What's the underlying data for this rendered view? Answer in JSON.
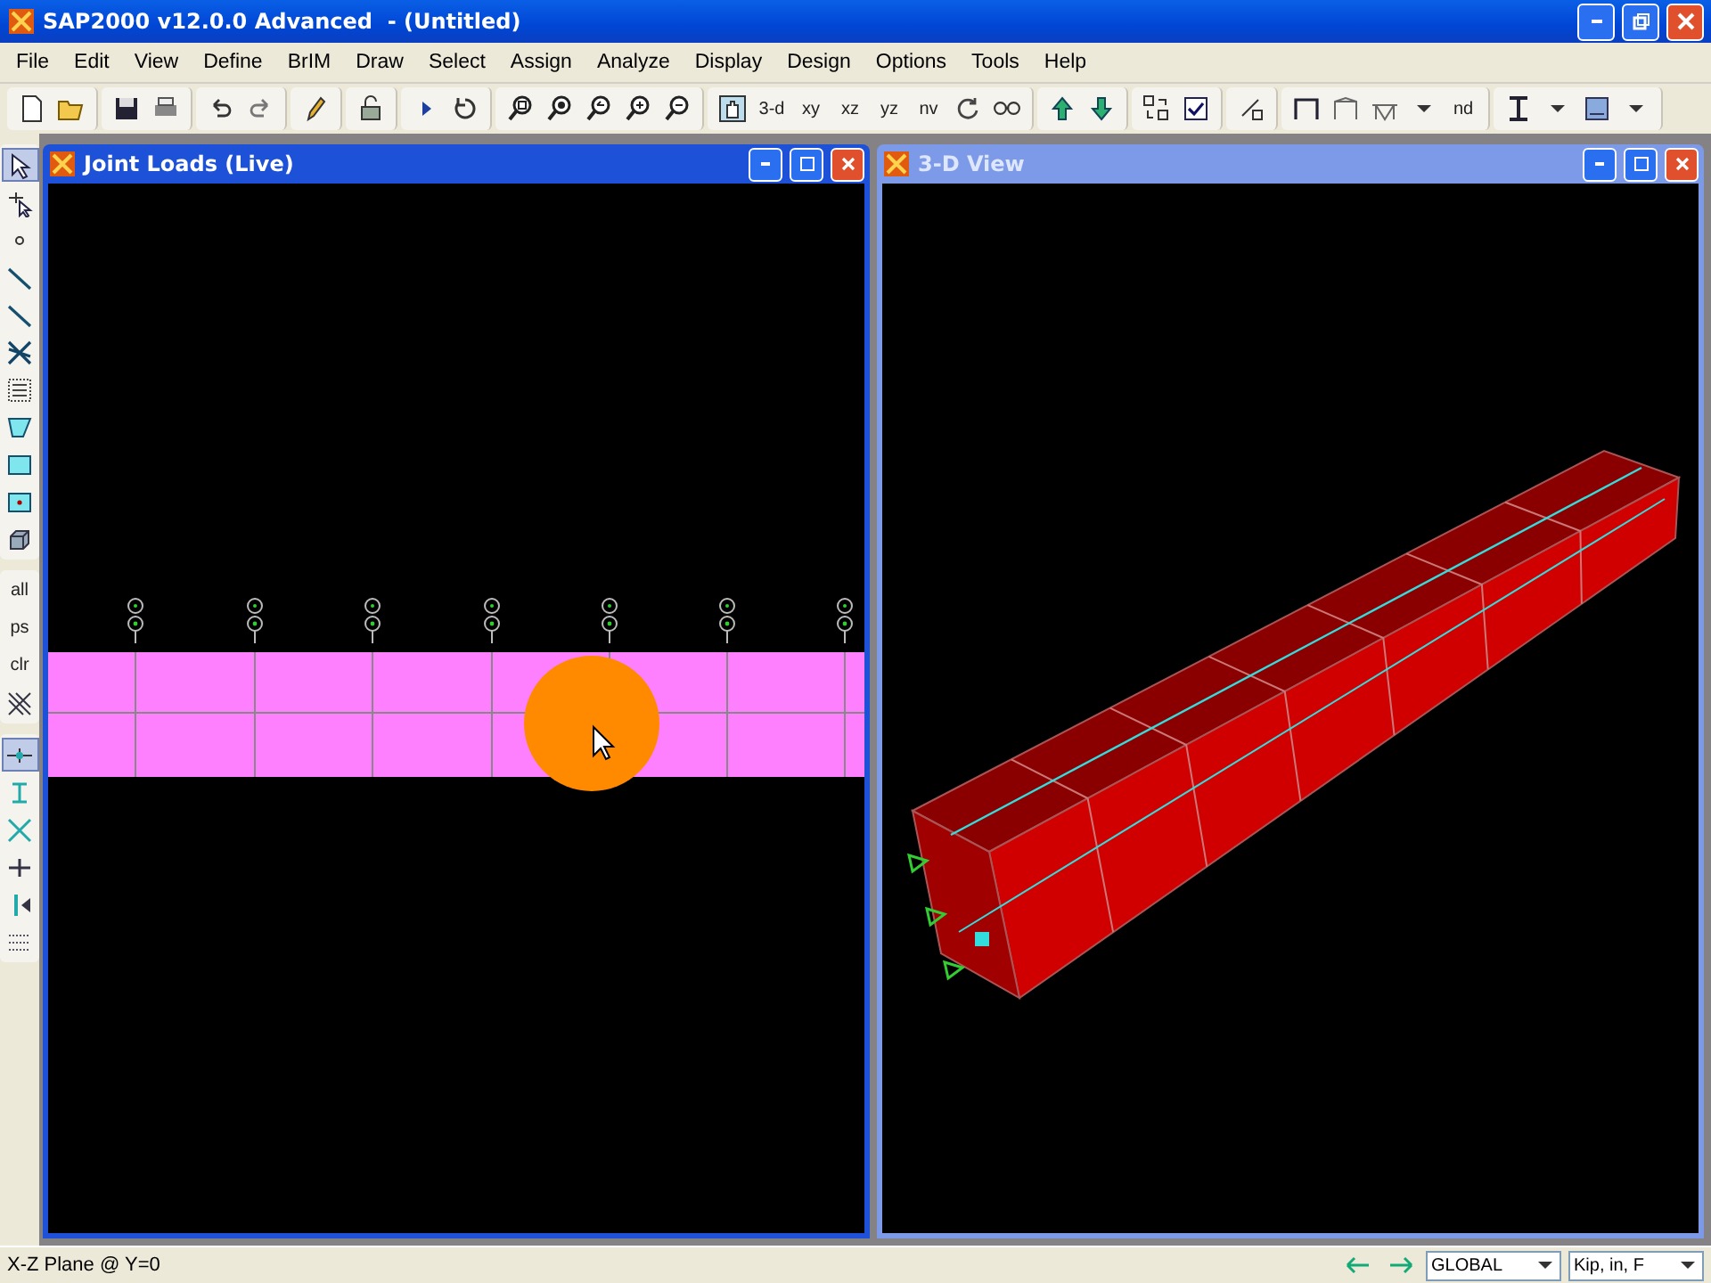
{
  "app": {
    "title": "SAP2000 v12.0.0 Advanced  - (Untitled)"
  },
  "menu": [
    "File",
    "Edit",
    "View",
    "Define",
    "BrIM",
    "Draw",
    "Select",
    "Assign",
    "Analyze",
    "Display",
    "Design",
    "Options",
    "Tools",
    "Help"
  ],
  "toolbar": {
    "text_buttons": [
      "3-d",
      "xy",
      "xz",
      "yz",
      "nv",
      "nd"
    ]
  },
  "left_toolbar": {
    "groups": [
      [
        {
          "kind": "icon",
          "selected": true
        },
        {
          "kind": "icon",
          "selected": false
        },
        {
          "kind": "icon",
          "selected": false
        },
        {
          "kind": "icon",
          "selected": false
        },
        {
          "kind": "icon",
          "selected": false
        },
        {
          "kind": "icon",
          "selected": false
        },
        {
          "kind": "icon",
          "selected": false
        },
        {
          "kind": "icon",
          "selected": false
        },
        {
          "kind": "icon",
          "selected": false
        },
        {
          "kind": "icon",
          "selected": false
        },
        {
          "kind": "icon",
          "selected": false
        }
      ],
      [
        {
          "kind": "text",
          "label": "all",
          "selected": false
        },
        {
          "kind": "text",
          "label": "ps",
          "selected": false
        },
        {
          "kind": "text",
          "label": "clr",
          "selected": false
        },
        {
          "kind": "icon",
          "selected": false
        }
      ],
      [
        {
          "kind": "icon",
          "selected": true
        },
        {
          "kind": "icon",
          "selected": false
        },
        {
          "kind": "icon",
          "selected": false
        },
        {
          "kind": "icon",
          "selected": false
        },
        {
          "kind": "icon",
          "selected": false
        },
        {
          "kind": "icon",
          "selected": false
        }
      ]
    ]
  },
  "windows": [
    {
      "title": "Joint Loads (Live)",
      "active": true,
      "kind": "elevation"
    },
    {
      "title": "3-D View",
      "active": false,
      "kind": "perspective"
    }
  ],
  "status_bar": {
    "text": "X-Z Plane @ Y=0",
    "coord_system": "GLOBAL",
    "units": "Kip, in, F"
  }
}
